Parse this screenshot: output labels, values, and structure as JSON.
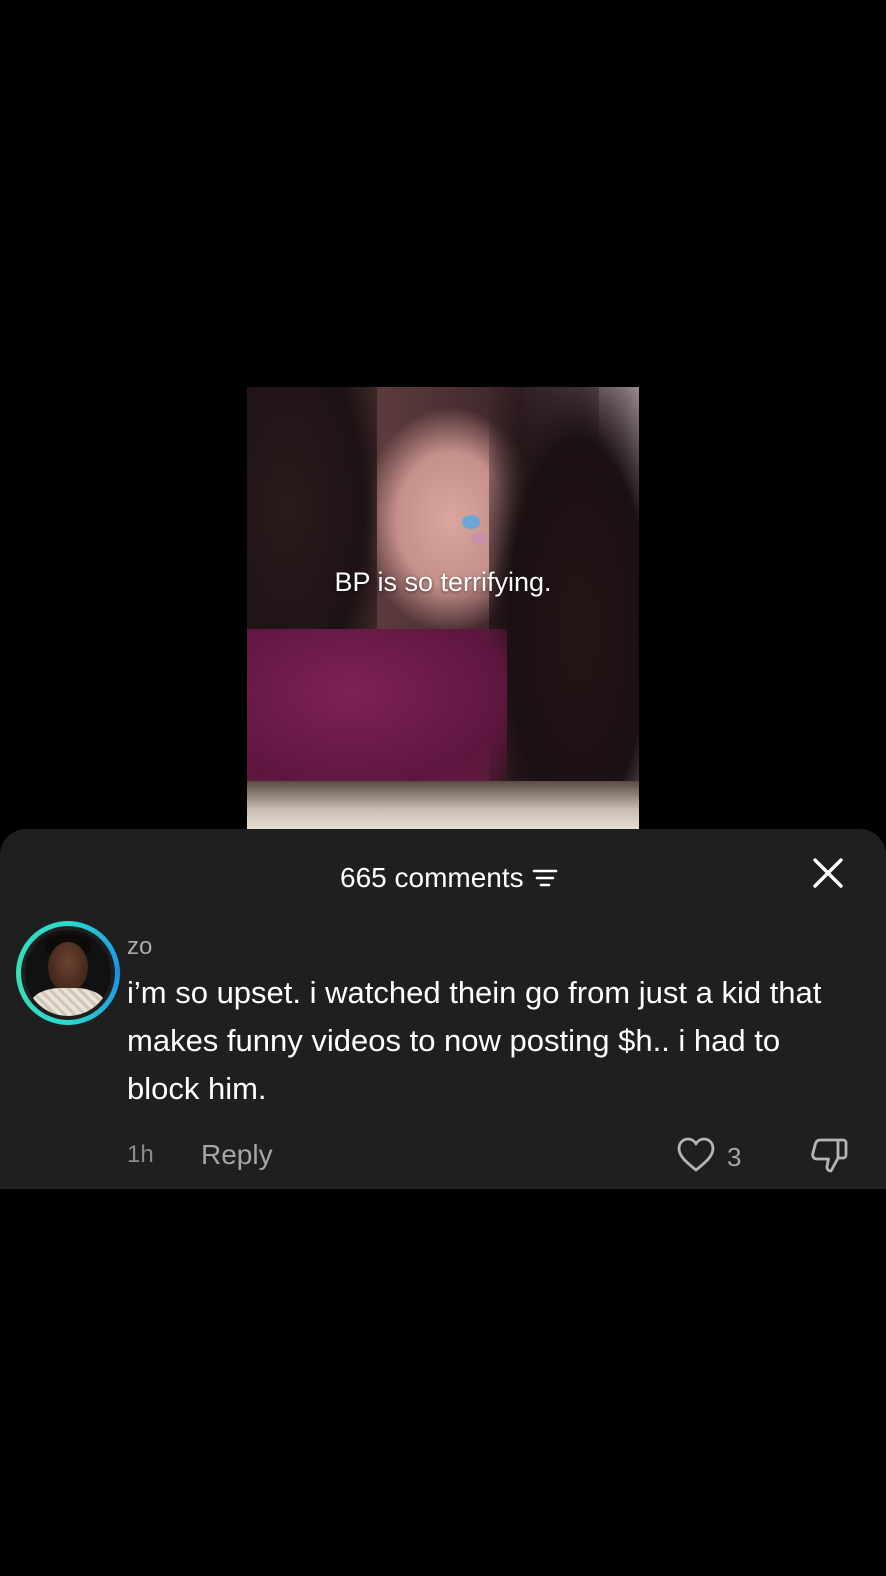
{
  "video": {
    "caption": "BP is so terrifying."
  },
  "comments_sheet": {
    "count_label": "665 comments",
    "sort_icon": "sort-lines-icon",
    "close_icon": "close-icon"
  },
  "comment": {
    "username": "zo",
    "text": "i’m so upset. i watched thein go from just a kid that makes funny videos to now posting $h.. i had to block him.",
    "timestamp": "1h",
    "reply_label": "Reply",
    "like_count": "3",
    "avatar_ring_colors": [
      "#2bd9d0",
      "#1b8fe8",
      "#36e0b6"
    ]
  },
  "colors": {
    "background": "#000000",
    "sheet": "#1f1f1f",
    "muted_text": "#a6a6a6"
  }
}
